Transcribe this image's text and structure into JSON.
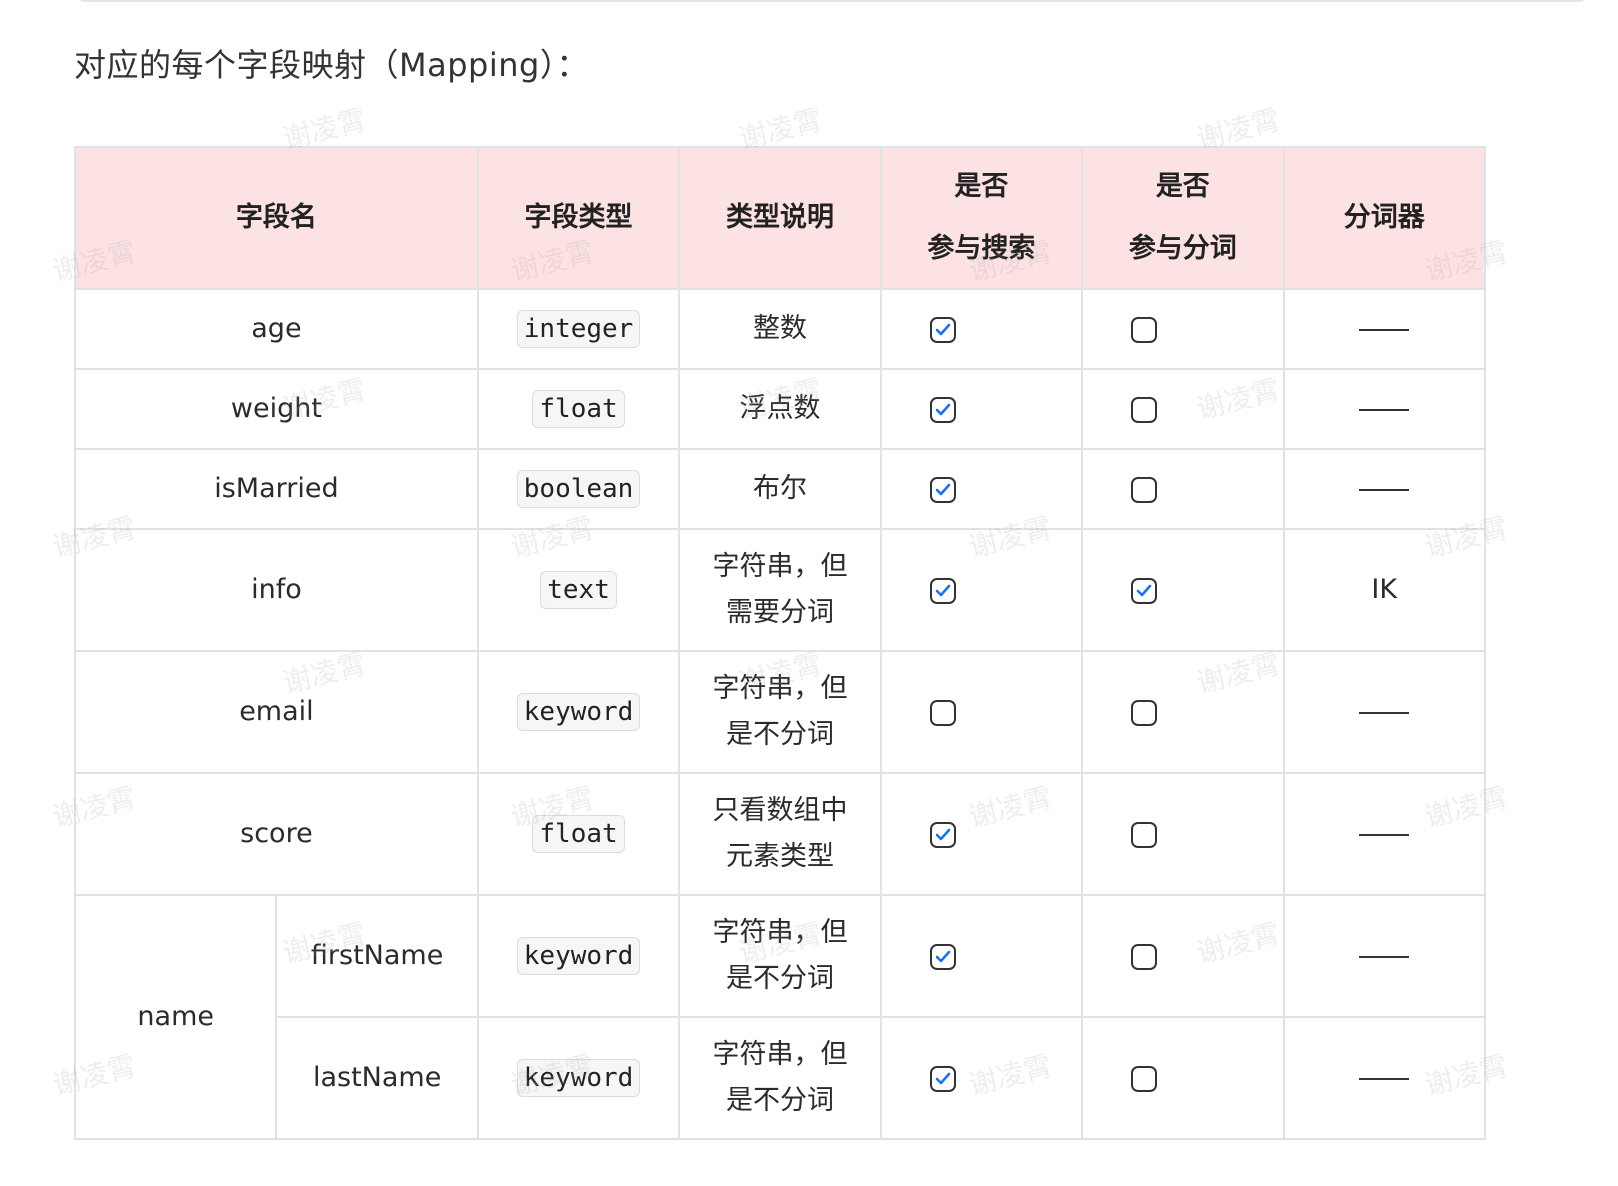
{
  "heading": "对应的每个字段映射（Mapping）：",
  "watermark_text": "谢凌霄",
  "accent_color": "#fde2e4",
  "check_color": "#1a73e8",
  "table": {
    "headers": {
      "field_name": "字段名",
      "field_type": "字段类型",
      "type_desc": "类型说明",
      "search_line1": "是否",
      "search_line2": "参与搜索",
      "tokenize_line1": "是否",
      "tokenize_line2": "参与分词",
      "analyzer": "分词器"
    },
    "rows": [
      {
        "name": "age",
        "type": "integer",
        "desc_line1": "整数",
        "desc_line2": "",
        "search": true,
        "tokenize": false,
        "analyzer": "——"
      },
      {
        "name": "weight",
        "type": "float",
        "desc_line1": "浮点数",
        "desc_line2": "",
        "search": true,
        "tokenize": false,
        "analyzer": "——"
      },
      {
        "name": "isMarried",
        "type": "boolean",
        "desc_line1": "布尔",
        "desc_line2": "",
        "search": true,
        "tokenize": false,
        "analyzer": "——"
      },
      {
        "name": "info",
        "type": "text",
        "desc_line1": "字符串，但",
        "desc_line2": "需要分词",
        "search": true,
        "tokenize": true,
        "analyzer": "IK"
      },
      {
        "name": "email",
        "type": "keyword",
        "desc_line1": "字符串，但",
        "desc_line2": "是不分词",
        "search": false,
        "tokenize": false,
        "analyzer": "——"
      },
      {
        "name": "score",
        "type": "float",
        "desc_line1": "只看数组中",
        "desc_line2": "元素类型",
        "search": true,
        "tokenize": false,
        "analyzer": "——"
      },
      {
        "parent": "name",
        "name": "firstName",
        "type": "keyword",
        "desc_line1": "字符串，但",
        "desc_line2": "是不分词",
        "search": true,
        "tokenize": false,
        "analyzer": "——"
      },
      {
        "parent": "name",
        "name": "lastName",
        "type": "keyword",
        "desc_line1": "字符串，但",
        "desc_line2": "是不分词",
        "search": true,
        "tokenize": false,
        "analyzer": "——"
      }
    ]
  }
}
